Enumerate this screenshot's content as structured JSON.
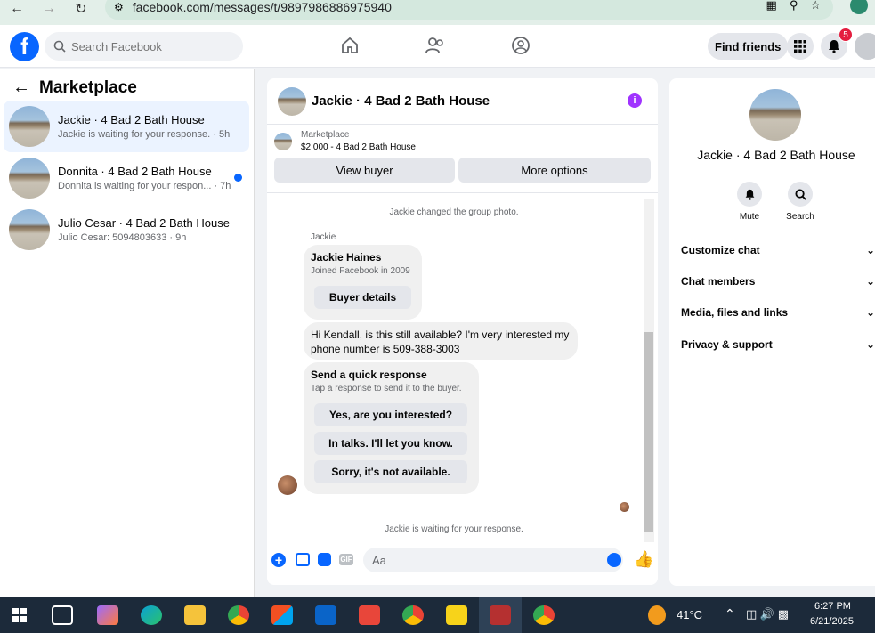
{
  "browser": {
    "url": "facebook.com/messages/t/9897986886975940"
  },
  "header": {
    "search_placeholder": "Search Facebook",
    "find_friends": "Find friends",
    "notif_count": "5",
    "logo_letter": "f"
  },
  "sidebar": {
    "title": "Marketplace",
    "conversations": [
      {
        "name": "Jackie · 4 Bad 2 Bath House",
        "sub": "Jackie is waiting for your response. · 5h"
      },
      {
        "name": "Donnita · 4 Bad 2 Bath House",
        "sub": "Donnita is waiting for your respon... · 7h"
      },
      {
        "name": "Julio Cesar · 4 Bad 2 Bath House",
        "sub": "Julio Cesar: 5094803633 · 9h"
      }
    ]
  },
  "chat": {
    "title": "Jackie · 4 Bad 2 Bath House",
    "marketplace_label": "Marketplace",
    "listing_price": "$2,000 - 4 Bad 2 Bath House",
    "view_buyer": "View buyer",
    "more_options": "More options",
    "group_photo_msg": "Jackie changed the group photo.",
    "sender_label": "Jackie",
    "profile_name": "Jackie Haines",
    "profile_joined": "Joined Facebook in 2009",
    "buyer_details": "Buyer details",
    "message_line1": "Hi Kendall, is this still available? I'm very interested my",
    "message_line2": "phone number is 509-388-3003",
    "quick_title": "Send a quick response",
    "quick_sub": "Tap a response to send it to the buyer.",
    "quick_responses": [
      "Yes, are you interested?",
      "In talks. I'll let you know.",
      "Sorry, it's not available."
    ],
    "waiting_msg": "Jackie is waiting for your response.",
    "composer_placeholder": "Aa"
  },
  "info": {
    "name": "Jackie · 4 Bad 2 Bath House",
    "mute": "Mute",
    "search": "Search",
    "sections": [
      "Customize chat",
      "Chat members",
      "Media, files and links",
      "Privacy & support"
    ]
  },
  "taskbar": {
    "temp": "41°C",
    "time": "6:27 PM",
    "date": "6/21/2025"
  },
  "colors": {
    "brand_blue": "#0866ff",
    "info_purple": "#a033ff",
    "badge_red": "#e41e3f"
  }
}
